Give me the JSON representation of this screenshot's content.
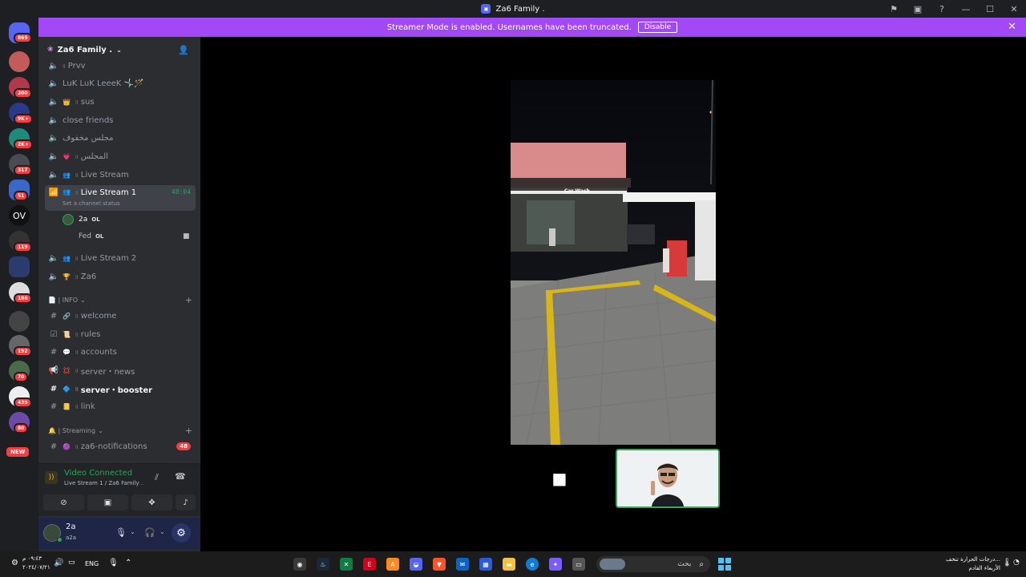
{
  "window": {
    "title": "Za6 Family ."
  },
  "banner": {
    "text": "Streamer Mode is enabled. Usernames have been truncated.",
    "disable_label": "Disable"
  },
  "servers": {
    "badges": [
      "869",
      "200",
      "9K+",
      "2K+",
      "317",
      "51",
      "119",
      "186",
      "192",
      "70",
      "439",
      "80"
    ],
    "ov_label": "OV",
    "new_label": "NEW"
  },
  "guild": {
    "name": "Za6 Family ."
  },
  "voice_channels": [
    {
      "label": "Prvv",
      "emoji": ""
    },
    {
      "label": "LuK LuK LeeeK 🤸🏻‍♂️🪄",
      "emoji": ""
    },
    {
      "label": "sus",
      "emoji": "👑"
    },
    {
      "label": "close friends",
      "emoji": ""
    },
    {
      "label": "مجلس مخفوف",
      "emoji": ""
    },
    {
      "label": "المجلس",
      "emoji": "💗"
    },
    {
      "label": "Live Stream",
      "emoji": "👥"
    },
    {
      "label": "Live Stream 1",
      "emoji": "👥"
    },
    {
      "label": "Live Stream 2",
      "emoji": "👥"
    },
    {
      "label": "Za6",
      "emoji": "🏆"
    }
  ],
  "active_channel": {
    "timer": "48:04",
    "status_hint": "Set a channel status"
  },
  "voice_users": [
    {
      "name": "2a",
      "tag": "OL"
    },
    {
      "name": "Fed",
      "tag": "OL"
    }
  ],
  "info_category": {
    "label": "📄 | INFO"
  },
  "info_channels": [
    {
      "label": "welcome",
      "emoji": "🔗"
    },
    {
      "label": "rules",
      "emoji": "📜"
    },
    {
      "label": "accounts",
      "emoji": "💬"
    },
    {
      "label": "server・news",
      "emoji": "💢"
    },
    {
      "label": "server・booster",
      "emoji": "🔷"
    },
    {
      "label": "link",
      "emoji": "📒"
    }
  ],
  "streaming_category": {
    "label": "🔔 | Streaming"
  },
  "streaming_channels": [
    {
      "label": "za6-notifications",
      "emoji": "🟣",
      "badge": "48"
    }
  ],
  "voice_panel": {
    "status": "Video Connected",
    "location": "Live Stream 1 / Za6 Family ."
  },
  "user_panel": {
    "name": "2a",
    "subtext": "a2a"
  },
  "taskbar": {
    "time": "٠٩:٤٣ م",
    "date": "٢٠٢٤/٠٧/٢١",
    "lang": "ENG",
    "search_placeholder": "بحث",
    "weather_title": "درجات الحرارة تنخف...",
    "weather_sub": "الأربعاء القادم"
  },
  "colors": {
    "accent": "#5865f2",
    "banner": "#a348f5",
    "connected": "#23a55a",
    "badge": "#f23f43"
  }
}
